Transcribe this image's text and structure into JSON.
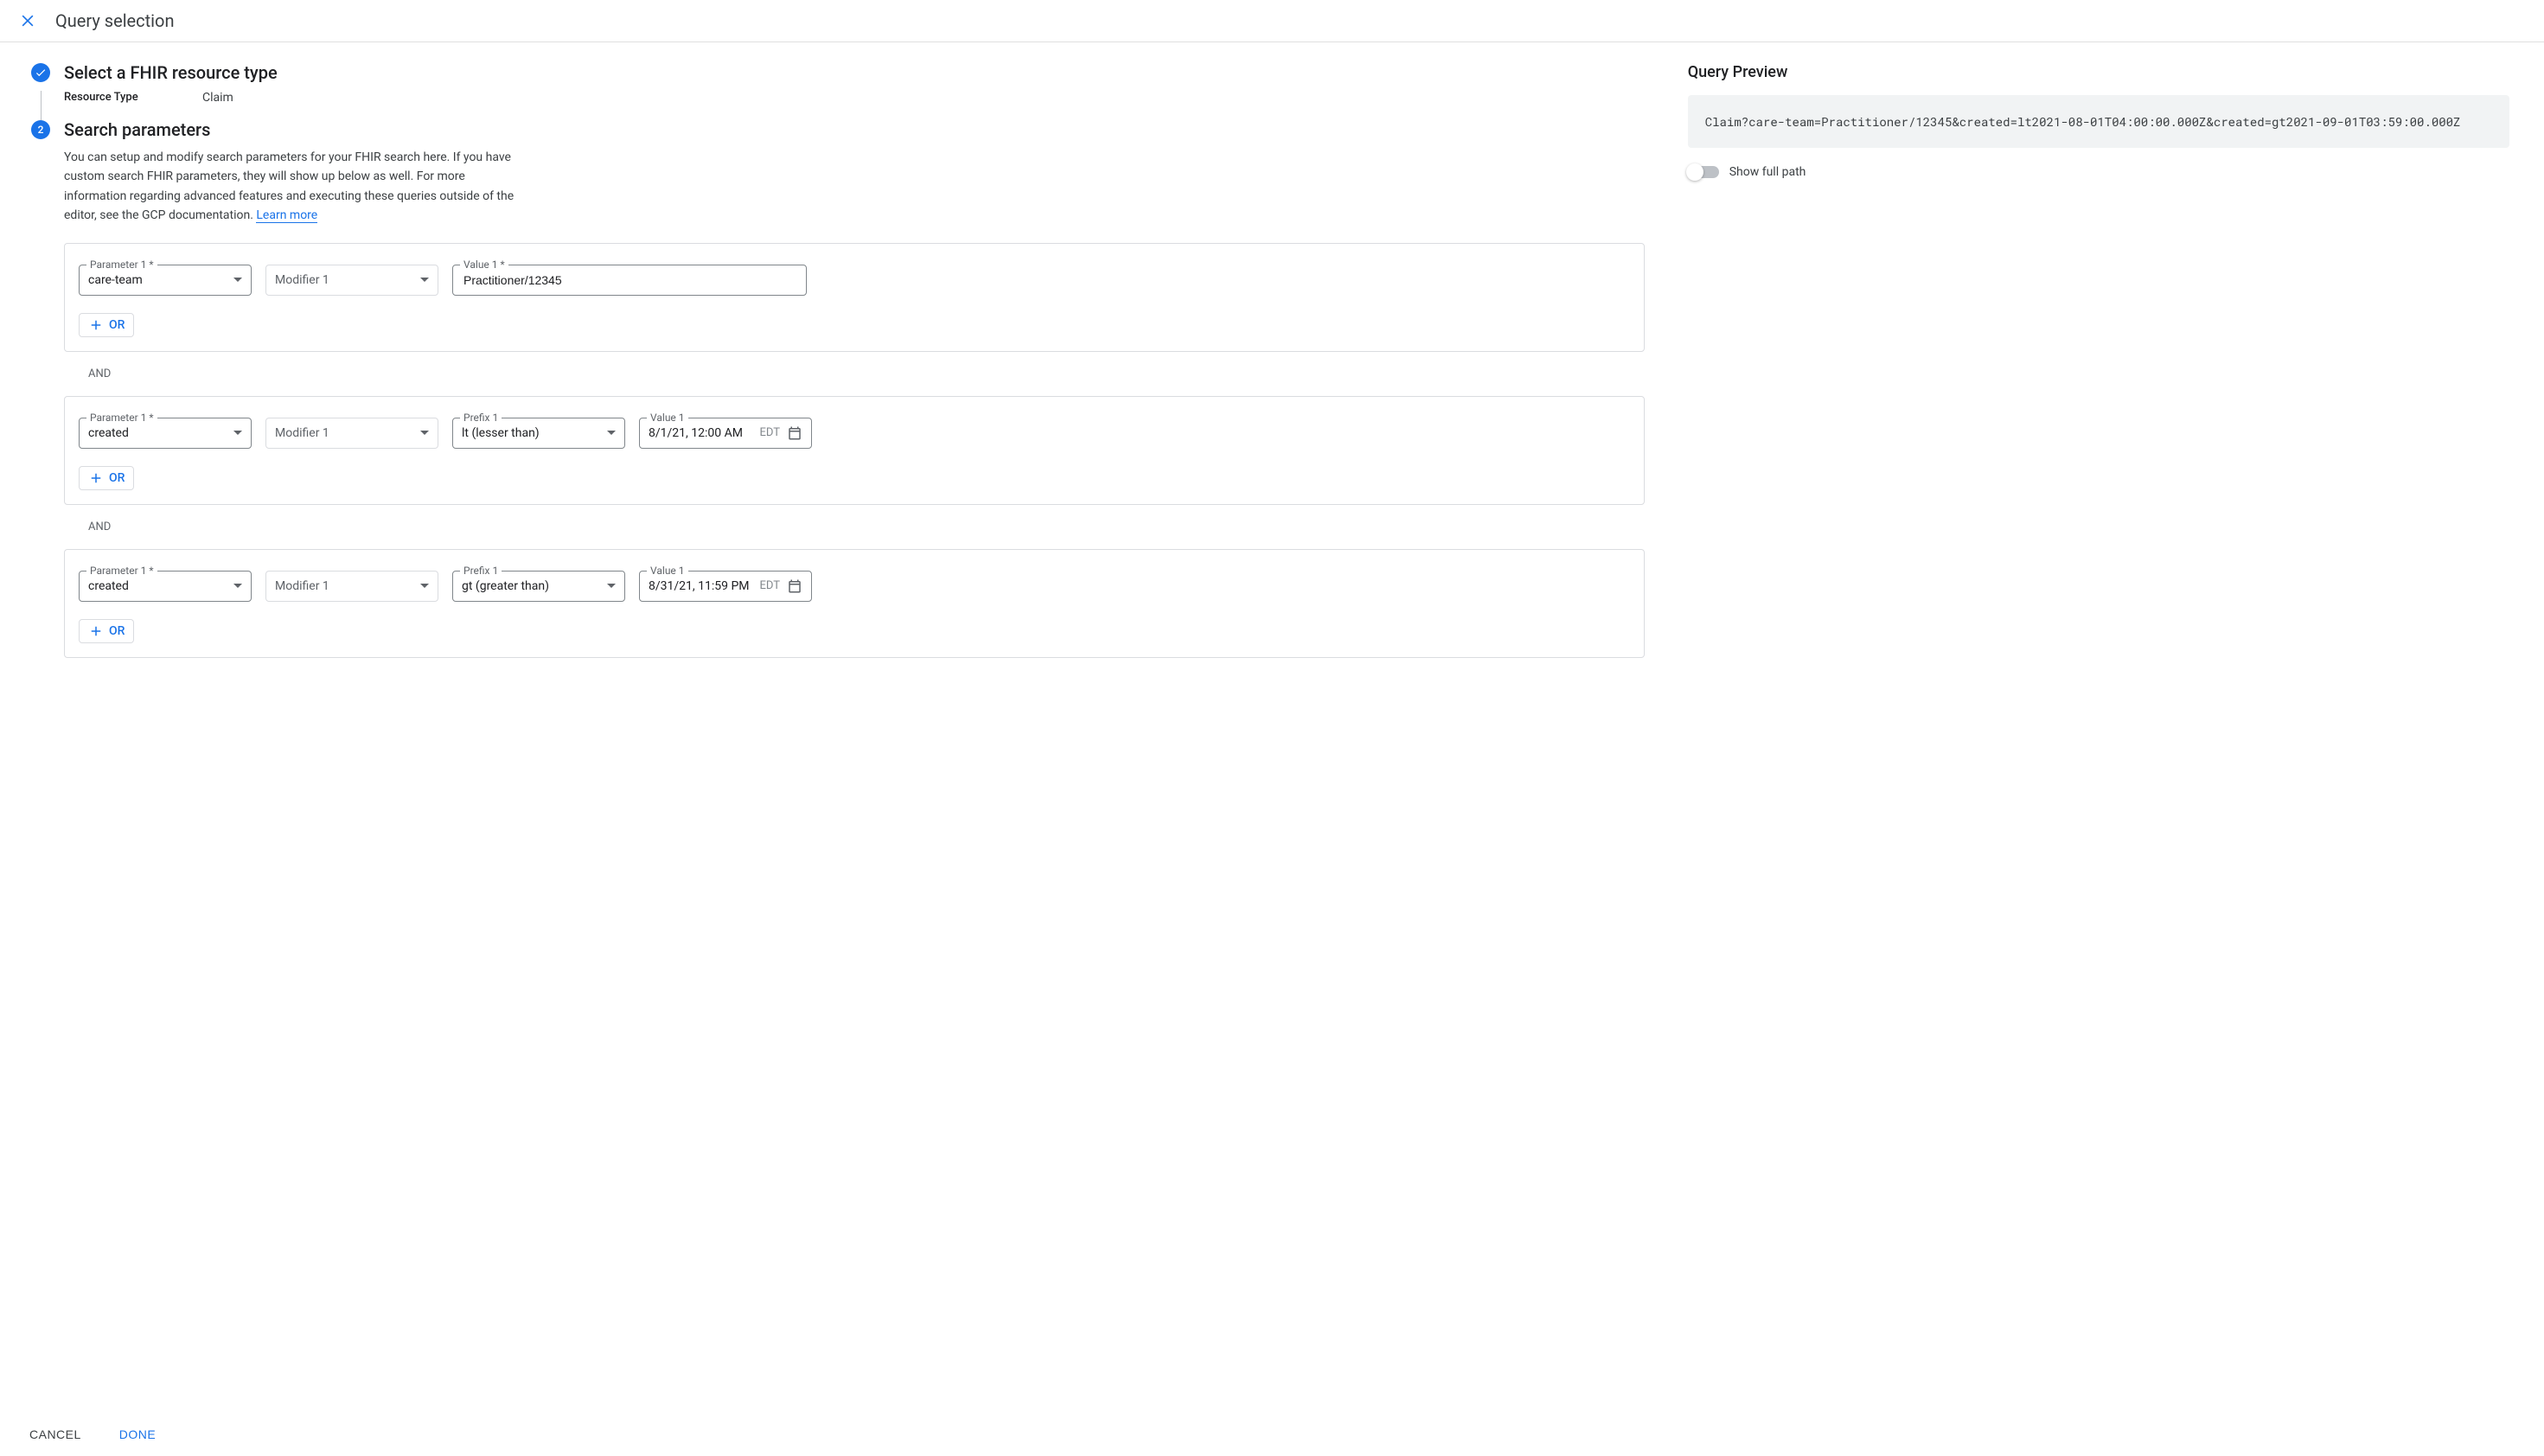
{
  "header": {
    "title": "Query selection"
  },
  "step1": {
    "title": "Select a FHIR resource type",
    "resource_type_label": "Resource Type",
    "resource_type_value": "Claim"
  },
  "step2": {
    "number": "2",
    "title": "Search parameters",
    "description_part1": "You can setup and modify search parameters for your FHIR search here. If you have custom search FHIR parameters, they will show up below as well. For more information regarding advanced features and executing these queries outside of the editor, see the GCP documentation. ",
    "learn_more": "Learn more"
  },
  "and_label": "AND",
  "or_label": "OR",
  "cards": [
    {
      "param_label": "Parameter 1 *",
      "param_value": "care-team",
      "modifier_label": "Modifier 1",
      "value_label": "Value 1 *",
      "value_value": "Practitioner/12345",
      "has_prefix": false,
      "has_date": false
    },
    {
      "param_label": "Parameter 1 *",
      "param_value": "created",
      "modifier_label": "Modifier 1",
      "prefix_label": "Prefix 1",
      "prefix_value": "lt (lesser than)",
      "value_label": "Value 1",
      "value_value": "8/1/21, 12:00 AM",
      "tz": "EDT",
      "has_prefix": true,
      "has_date": true
    },
    {
      "param_label": "Parameter 1 *",
      "param_value": "created",
      "modifier_label": "Modifier 1",
      "prefix_label": "Prefix 1",
      "prefix_value": "gt (greater than)",
      "value_label": "Value 1",
      "value_value": "8/31/21, 11:59 PM",
      "tz": "EDT",
      "has_prefix": true,
      "has_date": true
    }
  ],
  "preview": {
    "title": "Query Preview",
    "text": "Claim?care-team=Practitioner/12345&created=lt2021-08-01T04:00:00.000Z&created=gt2021-09-01T03:59:00.000Z",
    "show_full_path_label": "Show full path"
  },
  "footer": {
    "cancel": "CANCEL",
    "done": "DONE"
  }
}
